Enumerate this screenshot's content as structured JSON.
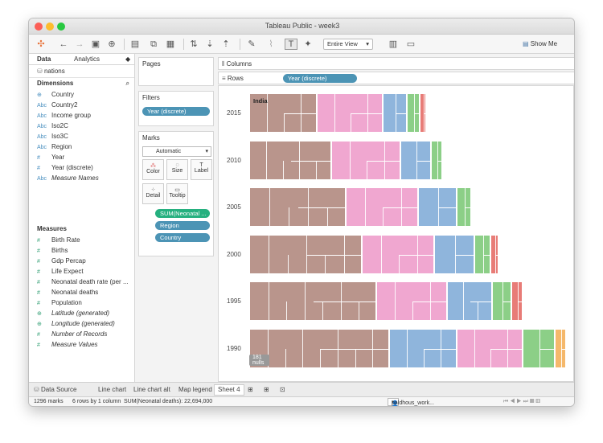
{
  "window": {
    "title": "Tableau Public - week3"
  },
  "toolbar": {
    "view_select": "Entire View",
    "show_me": "Show Me"
  },
  "left_pane": {
    "tabs": [
      "Data",
      "Analytics"
    ],
    "data_source": "nations",
    "dimensions_header": "Dimensions",
    "dimensions": [
      {
        "icon": "globe",
        "label": "Country"
      },
      {
        "icon": "abc",
        "label": "Country2"
      },
      {
        "icon": "abc",
        "label": "Income group"
      },
      {
        "icon": "abc",
        "label": "Iso2C"
      },
      {
        "icon": "abc",
        "label": "Iso3C"
      },
      {
        "icon": "abc",
        "label": "Region"
      },
      {
        "icon": "hash",
        "label": "Year"
      },
      {
        "icon": "hash",
        "label": "Year (discrete)"
      },
      {
        "icon": "abc",
        "label": "Measure Names"
      }
    ],
    "measures_header": "Measures",
    "measures": [
      {
        "icon": "hash",
        "label": "Birth Rate"
      },
      {
        "icon": "hash",
        "label": "Births"
      },
      {
        "icon": "hash",
        "label": "Gdp Percap"
      },
      {
        "icon": "hash",
        "label": "Life Expect"
      },
      {
        "icon": "hash",
        "label": "Neonatal death rate (per ..."
      },
      {
        "icon": "hash",
        "label": "Neonatal deaths"
      },
      {
        "icon": "hash",
        "label": "Population"
      },
      {
        "icon": "globe",
        "label": "Latitude (generated)"
      },
      {
        "icon": "globe",
        "label": "Longitude (generated)"
      },
      {
        "icon": "hash",
        "label": "Number of Records"
      },
      {
        "icon": "hash",
        "label": "Measure Values"
      }
    ]
  },
  "shelves": {
    "pages": "Pages",
    "filters": "Filters",
    "filter_pill": "Year (discrete)",
    "marks": "Marks",
    "mark_type": "Automatic",
    "mark_buttons": [
      "Color",
      "Size",
      "Label",
      "Detail",
      "Tooltip"
    ],
    "mark_pills": [
      "SUM(Neonatal ...",
      "Region",
      "Country"
    ],
    "columns": "Columns",
    "rows": "Rows",
    "rows_pill": "Year (discrete)"
  },
  "viz": {
    "label": "India",
    "nulls": "181 nulls",
    "colors": {
      "brown": "#b9958c",
      "pink": "#f0a7d0",
      "blue": "#8fb5dc",
      "green": "#8ccf87",
      "red": "#e87c77",
      "orange": "#f5b86b",
      "purple": "#b89ad2",
      "tan": "#d9c98f"
    }
  },
  "chart_data": {
    "type": "treemap",
    "rows": [
      "2015",
      "2010",
      "2005",
      "2000",
      "1995",
      "1990"
    ],
    "measure": "SUM(Neonatal deaths)",
    "color": "Region",
    "detail": "Country",
    "highlighted_label": "India",
    "total": "22,694,000"
  },
  "sheet_tabs": [
    "Data Source",
    "Line chart",
    "Line chart alt",
    "Map legend",
    "Sheet 4"
  ],
  "status": {
    "marks": "1296 marks",
    "rows_cols": "6 rows by 1 column",
    "sum": "SUM(Neonatal deaths): 22,694,000",
    "user": "paldhous_work..."
  }
}
